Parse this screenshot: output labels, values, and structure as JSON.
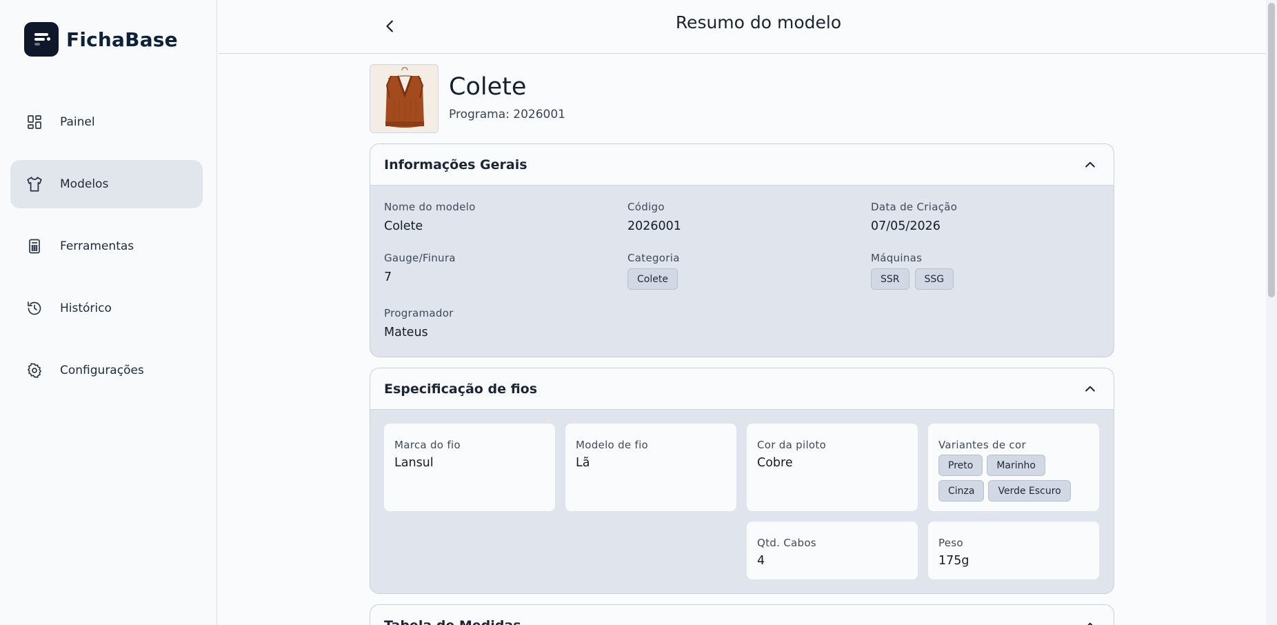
{
  "brand": {
    "name": "FichaBase"
  },
  "sidebar": {
    "items": [
      {
        "label": "Painel",
        "icon": "dashboard-icon",
        "active": false
      },
      {
        "label": "Modelos",
        "icon": "shirt-icon",
        "active": true
      },
      {
        "label": "Ferramentas",
        "icon": "calculator-icon",
        "active": false
      },
      {
        "label": "Histórico",
        "icon": "history-icon",
        "active": false
      },
      {
        "label": "Configurações",
        "icon": "gear-icon",
        "active": false
      }
    ]
  },
  "header": {
    "title": "Resumo do modelo",
    "back_icon": "chevron-left-icon",
    "menu_icon": "more-vertical-icon"
  },
  "model": {
    "name": "Colete",
    "program": "Programa: 2026001"
  },
  "general": {
    "title": "Informações Gerais",
    "name_label": "Nome do modelo",
    "name_value": "Colete",
    "code_label": "Código",
    "code_value": "2026001",
    "date_label": "Data de Criação",
    "date_value": "07/05/2026",
    "gauge_label": "Gauge/Finura",
    "gauge_value": "7",
    "category_label": "Categoria",
    "category_value": "Colete",
    "machines_label": "Máquinas",
    "machines": [
      "SSR",
      "SSG"
    ],
    "programmer_label": "Programador",
    "programmer_value": "Mateus"
  },
  "yarn": {
    "title": "Especificação de fios",
    "brand_label": "Marca do fio",
    "brand_value": "Lansul",
    "model_label": "Modelo de fio",
    "model_value": "Lã",
    "pilot_label": "Cor da piloto",
    "pilot_value": "Cobre",
    "variants_label": "Variantes de cor",
    "variants": [
      "Preto",
      "Marinho",
      "Cinza",
      "Verde Escuro"
    ],
    "cables_label": "Qtd. Cabos",
    "cables_value": "4",
    "weight_label": "Peso",
    "weight_value": "175g"
  },
  "measures": {
    "title": "Tabela de Medidas"
  },
  "colors": {
    "accent": "#0f172a",
    "active_bg": "#e1e6ed",
    "card_body": "#dfe4ed"
  }
}
